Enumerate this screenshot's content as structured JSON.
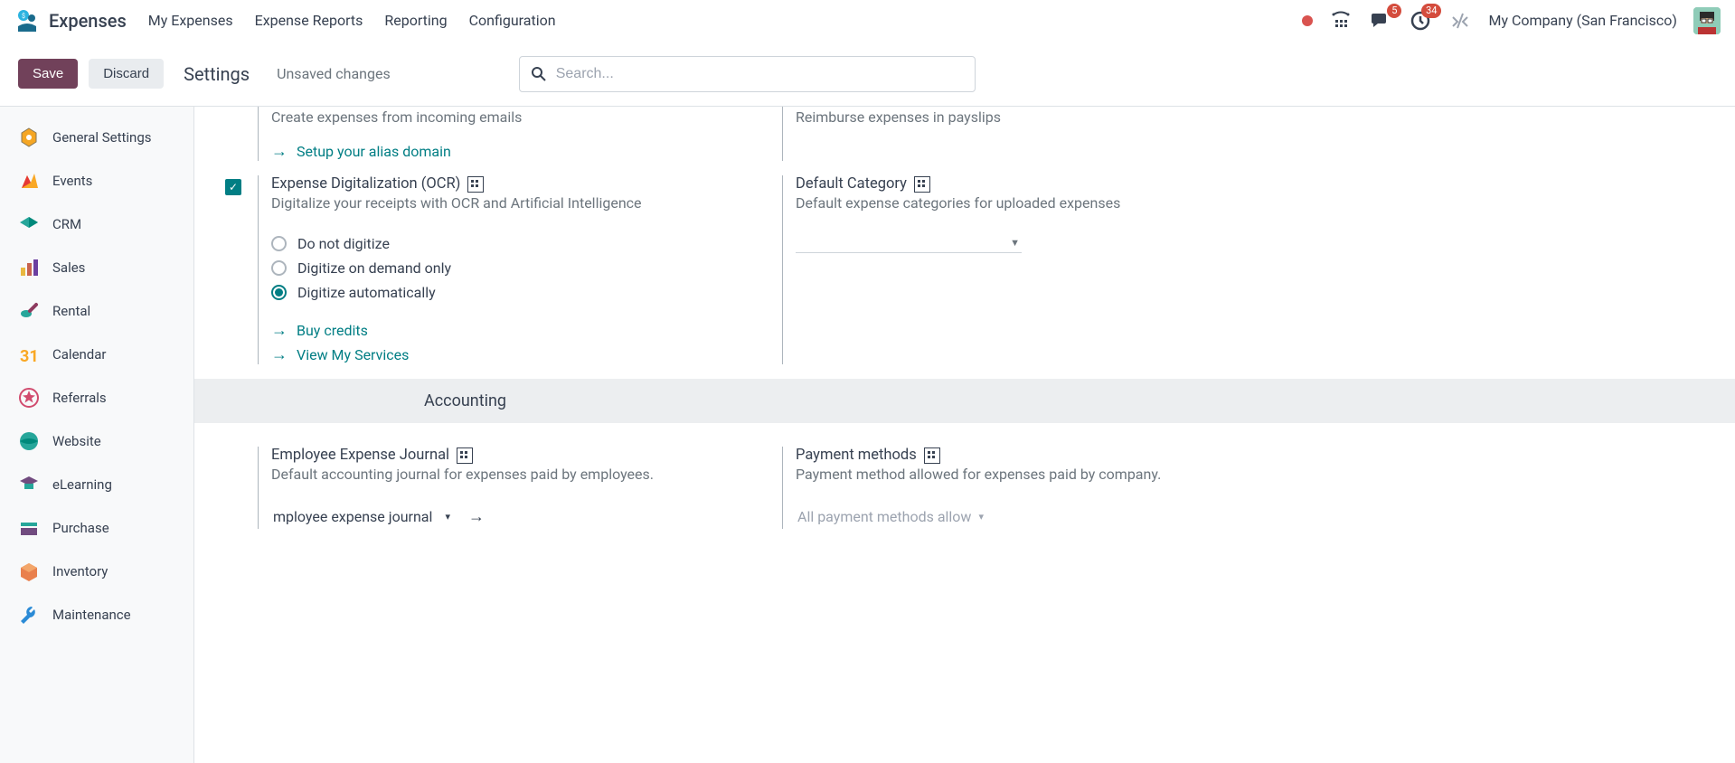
{
  "app": {
    "name": "Expenses"
  },
  "nav": {
    "items": [
      "My Expenses",
      "Expense Reports",
      "Reporting",
      "Configuration"
    ]
  },
  "header": {
    "company": "My Company (San Francisco)",
    "messages_badge": "5",
    "activities_badge": "34"
  },
  "controlbar": {
    "save": "Save",
    "discard": "Discard",
    "breadcrumb": "Settings",
    "status": "Unsaved changes",
    "search_placeholder": "Search..."
  },
  "sidebar": {
    "items": [
      {
        "label": "General Settings"
      },
      {
        "label": "Events"
      },
      {
        "label": "CRM"
      },
      {
        "label": "Sales"
      },
      {
        "label": "Rental"
      },
      {
        "label": "Calendar"
      },
      {
        "label": "Referrals"
      },
      {
        "label": "Website"
      },
      {
        "label": "eLearning"
      },
      {
        "label": "Purchase"
      },
      {
        "label": "Inventory"
      },
      {
        "label": "Maintenance"
      }
    ]
  },
  "settings": {
    "emails": {
      "desc": "Create expenses from incoming emails",
      "link": "Setup your alias domain"
    },
    "payslips": {
      "desc": "Reimburse expenses in payslips"
    },
    "ocr": {
      "title": "Expense Digitalization (OCR)",
      "desc": "Digitalize your receipts with OCR and Artificial Intelligence",
      "opt1": "Do not digitize",
      "opt2": "Digitize on demand only",
      "opt3": "Digitize automatically",
      "buy": "Buy credits",
      "view": "View My Services"
    },
    "defaultcat": {
      "title": "Default Category",
      "desc": "Default expense categories for uploaded expenses"
    },
    "accounting_header": "Accounting",
    "empjournal": {
      "title": "Employee Expense Journal",
      "desc": "Default accounting journal for expenses paid by employees.",
      "value": "mployee expense journal"
    },
    "paymethods": {
      "title": "Payment methods",
      "desc": "Payment method allowed for expenses paid by company.",
      "value": "All payment methods allow"
    }
  }
}
